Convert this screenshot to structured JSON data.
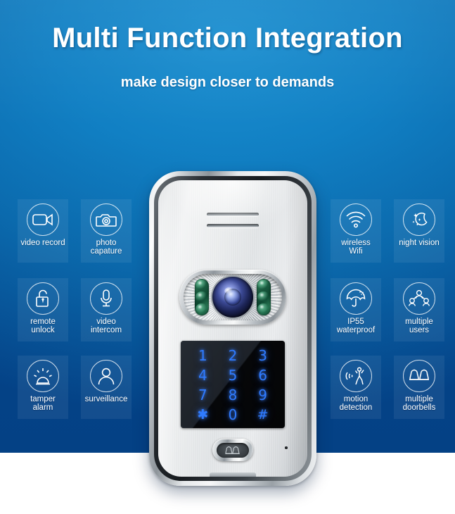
{
  "header": {
    "title": "Multi Function Integration",
    "subtitle": "make  design closer to demands"
  },
  "colors": {
    "background_blue_light": "#1c8fd0",
    "background_blue_dark": "#04458c",
    "tile_overlay": "rgba(255,255,255,0.065)",
    "caption_text": "#ffffff",
    "keypad_digit_glow": "#2f7bff",
    "keypad_panel": "#0b0c0e",
    "ir_led_green": "#1b5c40",
    "lens_blue": "#3c4a96",
    "device_metal": "#eceeef"
  },
  "features_left": [
    {
      "label": "video record",
      "icon": "video-camera-icon"
    },
    {
      "label": "photo capature",
      "icon": "camera-icon"
    },
    {
      "label": "remote\nunlock",
      "icon": "padlock-unlocked-icon"
    },
    {
      "label": "video\nintercom",
      "icon": "microphone-icon"
    },
    {
      "label": "tamper\nalarm",
      "icon": "siren-alarm-icon"
    },
    {
      "label": "surveillance",
      "icon": "person-silhouette-icon"
    }
  ],
  "features_right": [
    {
      "label": "wireless\nWifi",
      "icon": "wifi-icon"
    },
    {
      "label": "night vision",
      "icon": "moon-stars-icon"
    },
    {
      "label": "IP55\nwaterproof",
      "icon": "umbrella-rain-icon"
    },
    {
      "label": "multiple\nusers",
      "icon": "multiple-users-icon"
    },
    {
      "label": "motion\ndetection",
      "icon": "motion-sensor-icon"
    },
    {
      "label": "multiple\ndoorbells",
      "icon": "two-bells-icon"
    }
  ],
  "device": {
    "name": "video-door-phone-outdoor-station",
    "speaker_slots": 2,
    "camera": {
      "ir_leds_per_side": 3,
      "lens": "fisheye-lens"
    },
    "keypad": {
      "rows": [
        [
          "1",
          "2",
          "3"
        ],
        [
          "4",
          "5",
          "6"
        ],
        [
          "7",
          "8",
          "9"
        ],
        [
          "✱",
          "0",
          "#"
        ]
      ]
    },
    "call_button": {
      "icon": "bell-emblem-icon"
    },
    "microphone_hole": true
  }
}
